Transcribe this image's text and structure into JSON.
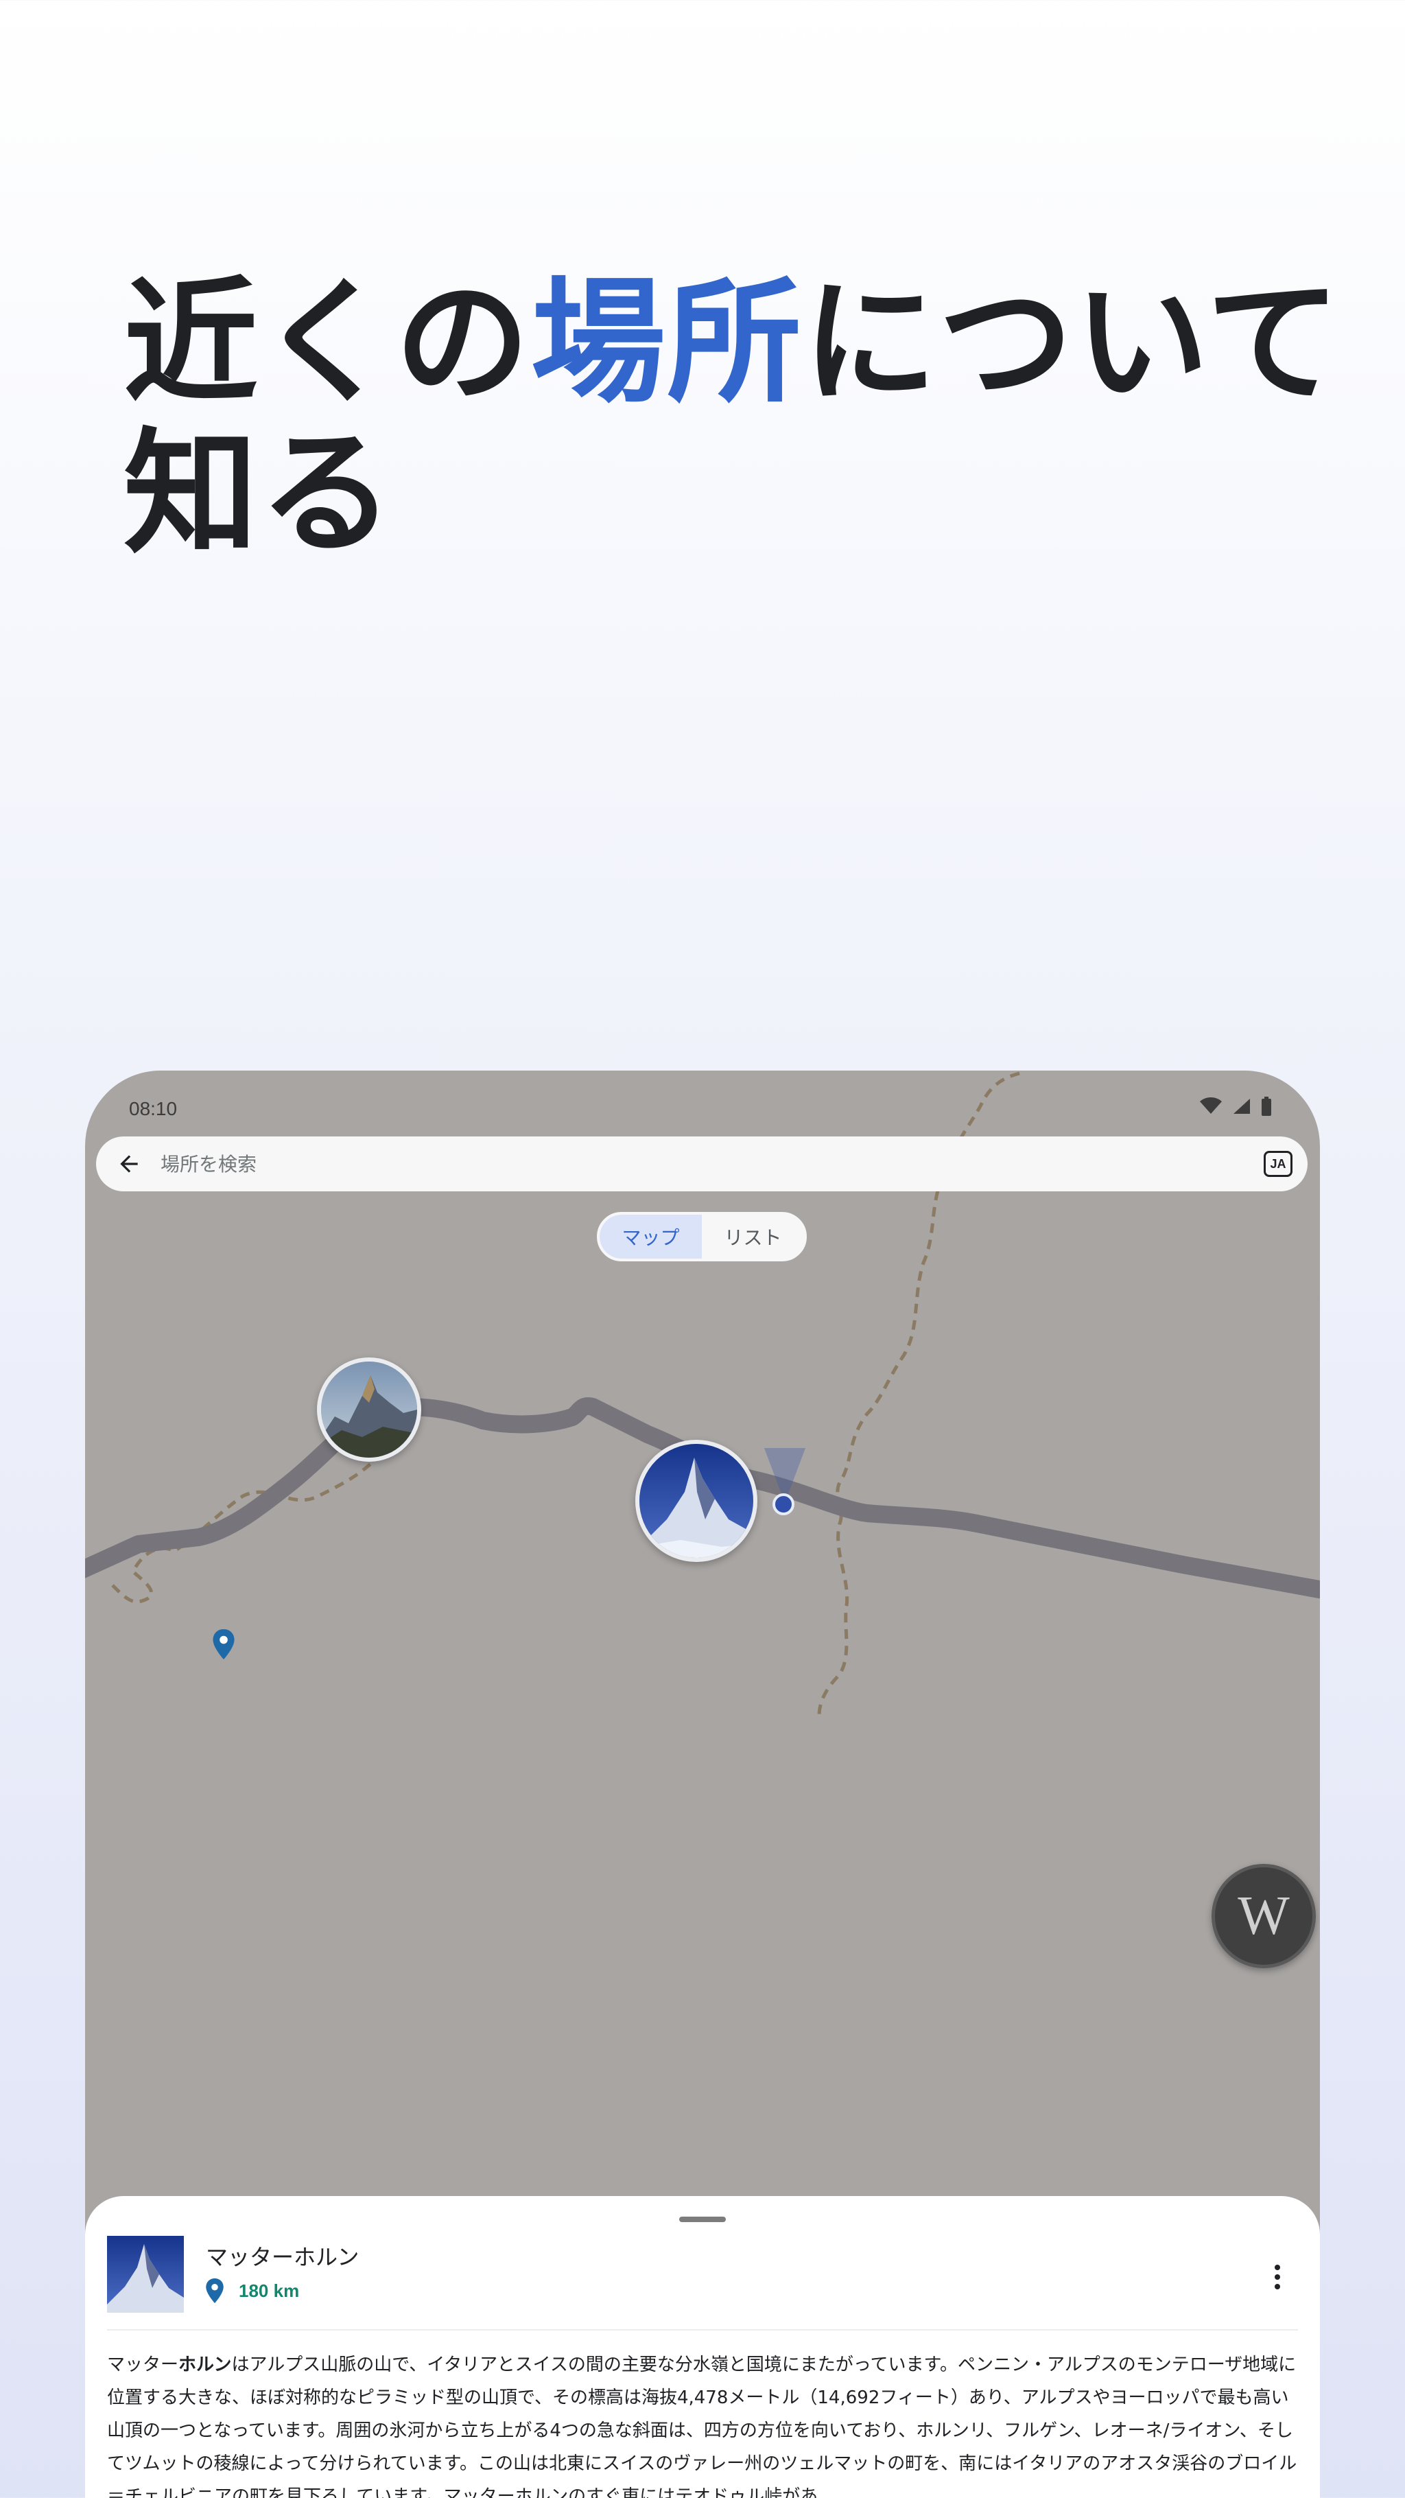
{
  "headline": {
    "line1_pre": "近くの",
    "line1_accent": "場所",
    "line1_post": "について",
    "line2": "知る",
    "accent_color": "#3366cc"
  },
  "status_bar": {
    "time": "08:10",
    "icons": [
      "wifi-icon",
      "cell-signal-icon",
      "battery-icon"
    ]
  },
  "search": {
    "placeholder": "場所を検索",
    "language_code": "JA"
  },
  "view_toggle": {
    "map_label": "マップ",
    "list_label": "リスト",
    "selected": "マップ"
  },
  "map": {
    "background_color": "#a8a5a3",
    "road_color": "#77757b",
    "trail_color": "#8c7b63"
  },
  "wiki_button": {
    "label": "W"
  },
  "place_sheet": {
    "title": "マッターホルン",
    "distance": "180 km",
    "description_bold": "マッターホルン",
    "description_prefix": "マッター",
    "description_bold_part": "ホルン",
    "description_rest": "はアルプス山脈の山で、イタリアとスイスの間の主要な分水嶺と国境にまたがっています。ペンニン・アルプスのモンテローザ地域に位置する大きな、ほぼ対称的なピラミッド型の山頂で、その標高は海抜4,478メートル（14,692フィート）あり、アルプスやヨーロッパで最も高い山頂の一つとなっています。周囲の氷河から立ち上がる4つの急な斜面は、四方の方位を向いており、ホルンリ、フルゲン、レオーネ/ライオン、そしてツムットの稜線によって分けられています。この山は北東にスイスのヴァレー州のツェルマットの町を、南にはイタリアのアオスタ渓谷のブロイル＝チェルビニアの町を見下ろしています。マッターホルンのすぐ東にはテオドゥル峠があ"
  }
}
